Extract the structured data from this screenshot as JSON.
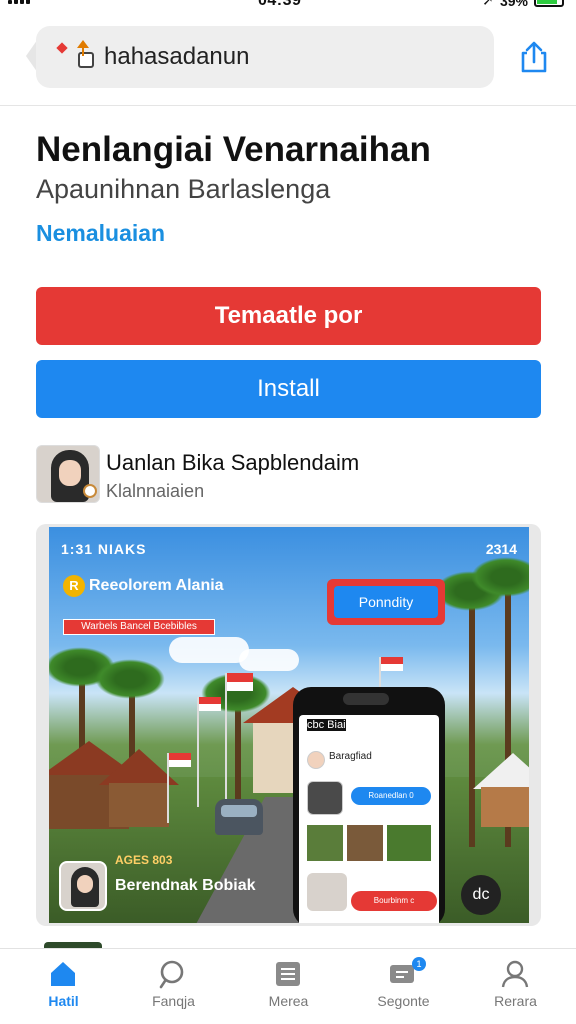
{
  "status_bar": {
    "time": "04:39",
    "battery": "39%"
  },
  "browser": {
    "url": "hahasadanun"
  },
  "app": {
    "title": "Nenlangiai Venarnaihan",
    "subtitle": "Apaunihnan Barlaslenga",
    "link": "Nemaluaian",
    "primary_button": "Temaatle por",
    "install_button": "Install",
    "developer_name": "Uanlan Bika Sapblendaim",
    "developer_sub": "Klalnnaiaien"
  },
  "screenshot": {
    "status_left": "1:31 NIAKS",
    "status_right": "2314",
    "tag_badge": "R",
    "tag_text": "Reeolorem Alania",
    "strip_text": "Warbels Bancel Bcebibles",
    "pill_label": "Ponndity",
    "caption_small": "AGES 803",
    "caption": "Berendnak Bobiak",
    "fab_label": "dc",
    "phone": {
      "top_left": "cbc Biai",
      "row1": "Baragfiad",
      "blue_chip": "Roanedlan 0",
      "red_chip": "Bourbinm c"
    }
  },
  "tabbar": {
    "tabs": [
      {
        "label": "Hatil",
        "icon": "home-icon",
        "active": true
      },
      {
        "label": "Fanqja",
        "icon": "search-icon",
        "active": false
      },
      {
        "label": "Merea",
        "icon": "list-icon",
        "active": false
      },
      {
        "label": "Segonte",
        "icon": "chat-icon",
        "active": false,
        "badge": "1"
      },
      {
        "label": "Rerara",
        "icon": "person-icon",
        "active": false
      }
    ]
  },
  "colors": {
    "accent_blue": "#1e88f0",
    "accent_red": "#e53935",
    "link_blue": "#1a8fe0"
  }
}
